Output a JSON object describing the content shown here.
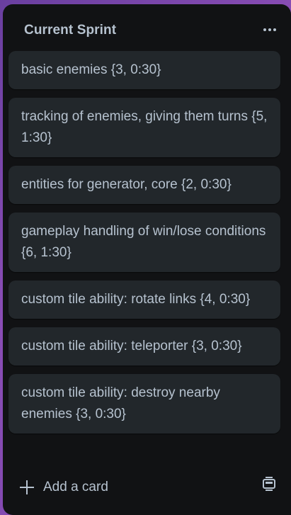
{
  "list": {
    "title": "Current Sprint",
    "menu_icon": "more-horizontal-icon",
    "cards": [
      {
        "text": "basic enemies {3, 0:30}"
      },
      {
        "text": "tracking of enemies, giving them turns {5, 1:30}"
      },
      {
        "text": "entities for generator, core {2, 0:30}"
      },
      {
        "text": "gameplay handling of win/lose conditions {6, 1:30}"
      },
      {
        "text": "custom tile ability: rotate links {4, 0:30}"
      },
      {
        "text": "custom tile ability: teleporter {3, 0:30}"
      },
      {
        "text": "custom tile ability: destroy nearby enemies {3, 0:30}"
      }
    ],
    "add_card_label": "Add a card",
    "add_icon": "plus-icon",
    "template_icon": "card-template-icon"
  },
  "colors": {
    "background": "#7a46ac",
    "list_bg": "#111214",
    "card_bg": "#22272b",
    "text": "#b6c2cf"
  }
}
